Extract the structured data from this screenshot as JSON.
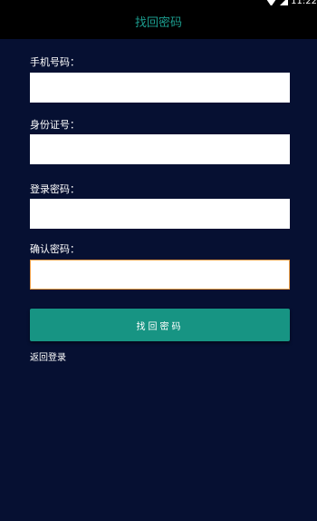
{
  "status_bar": {
    "time": "11:22",
    "icons": [
      "wifi-icon",
      "signal-icon"
    ]
  },
  "toolbar": {
    "title": "找回密码"
  },
  "form": {
    "phone": {
      "label": "手机号码：",
      "value": "",
      "placeholder": ""
    },
    "id_number": {
      "label": "身份证号：",
      "value": "",
      "placeholder": ""
    },
    "password": {
      "label": "登录密码：",
      "value": "",
      "placeholder": ""
    },
    "confirm_password": {
      "label": "确认密码：",
      "value": "",
      "placeholder": ""
    },
    "submit_label": "找回密码",
    "back_link": "返回登录"
  },
  "colors": {
    "background": "#061032",
    "toolbar": "#000000",
    "accent": "#179483",
    "title": "#1c9c8e",
    "focus_border": "#f0a048"
  }
}
